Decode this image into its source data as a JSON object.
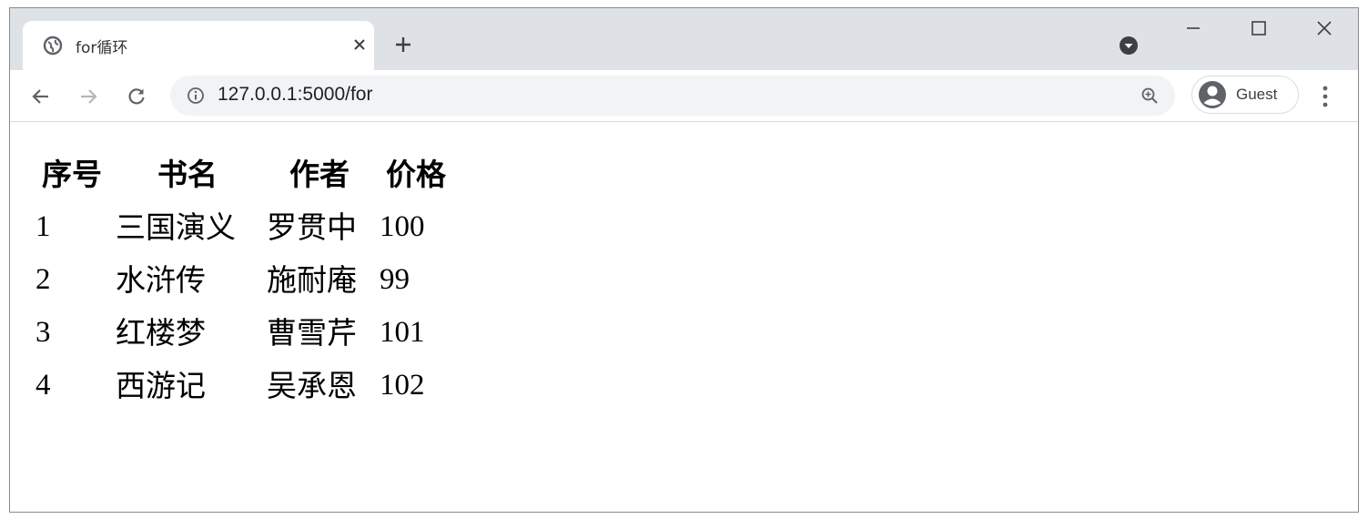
{
  "browser": {
    "tab_title": "for循环",
    "url": "127.0.0.1:5000/for",
    "profile_label": "Guest",
    "icons": {
      "favicon": "globe-icon",
      "tab_close": "close-icon",
      "new_tab": "plus-icon",
      "profile_menu": "chevron-down-circle-icon",
      "minimize": "minimize-icon",
      "maximize": "maximize-icon",
      "window_close": "close-icon",
      "back": "arrow-left-icon",
      "forward": "arrow-right-icon",
      "reload": "reload-icon",
      "site_info": "info-icon",
      "zoom": "zoom-icon",
      "avatar": "account-circle-icon",
      "menu": "kebab-menu-icon"
    }
  },
  "page": {
    "table": {
      "headers": [
        "序号",
        "书名",
        "作者",
        "价格"
      ],
      "rows": [
        [
          "1",
          "三国演义",
          "罗贯中",
          "100"
        ],
        [
          "2",
          "水浒传",
          "施耐庵",
          "99"
        ],
        [
          "3",
          "红楼梦",
          "曹雪芹",
          "101"
        ],
        [
          "4",
          "西游记",
          "吴承恩",
          "102"
        ]
      ]
    }
  },
  "colors": {
    "titlebar": "#dee1e6",
    "omnibox": "#f1f3f4",
    "icon": "#5f6368"
  }
}
